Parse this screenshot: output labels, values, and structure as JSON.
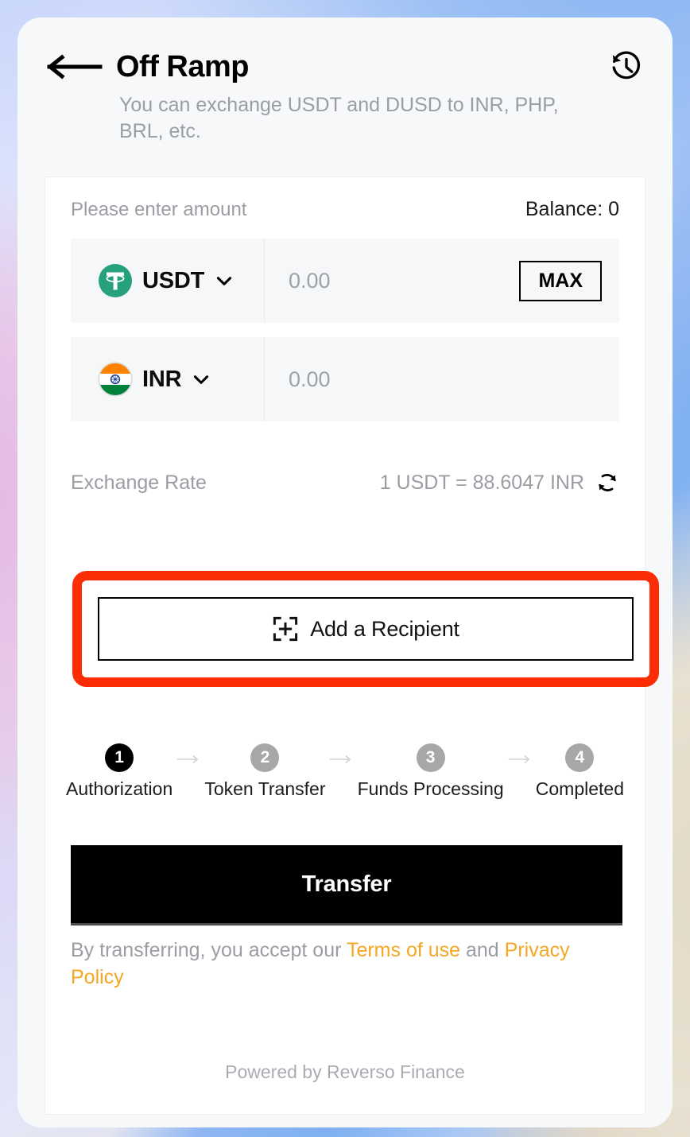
{
  "header": {
    "back_icon": "arrow-left-icon",
    "title": "Off Ramp",
    "history_icon": "history-clock-icon",
    "subtitle": "You can exchange USDT and DUSD to INR, PHP, BRL, etc."
  },
  "panel": {
    "amount_label": "Please enter amount",
    "balance_label": "Balance: 0",
    "rows": [
      {
        "currency": "USDT",
        "icon": "tether-coin-icon",
        "amount_value": "0.00",
        "amount_placeholder": "0.00",
        "chevron_icon": "chevron-down-icon",
        "max_label": "MAX",
        "has_max": true
      },
      {
        "currency": "INR",
        "icon": "india-flag-icon",
        "amount_value": "0.00",
        "amount_placeholder": "0.00",
        "chevron_icon": "chevron-down-icon",
        "has_max": false
      }
    ],
    "exchange": {
      "label": "Exchange Rate",
      "value": "1 USDT = 88.6047 INR",
      "refresh_icon": "refresh-icon"
    },
    "add_recipient": {
      "label": "Add a Recipient",
      "icon": "add-frame-plus-icon",
      "highlight_color": "#fc2c04"
    },
    "stepper": {
      "arrow_icon": "arrow-right-icon",
      "steps": [
        {
          "number": "1",
          "label": "Authorization",
          "active": true
        },
        {
          "number": "2",
          "label": "Token Transfer",
          "active": false
        },
        {
          "number": "3",
          "label": "Funds Processing",
          "active": false
        },
        {
          "number": "4",
          "label": "Completed",
          "active": false
        }
      ]
    },
    "transfer_label": "Transfer",
    "terms": {
      "prefix": "By transferring, you accept our ",
      "terms_link": "Terms of use",
      "middle": " and ",
      "privacy_link": "Privacy Policy",
      "link_color": "#f5a623"
    },
    "powered_by": "Powered by Reverso Finance"
  }
}
